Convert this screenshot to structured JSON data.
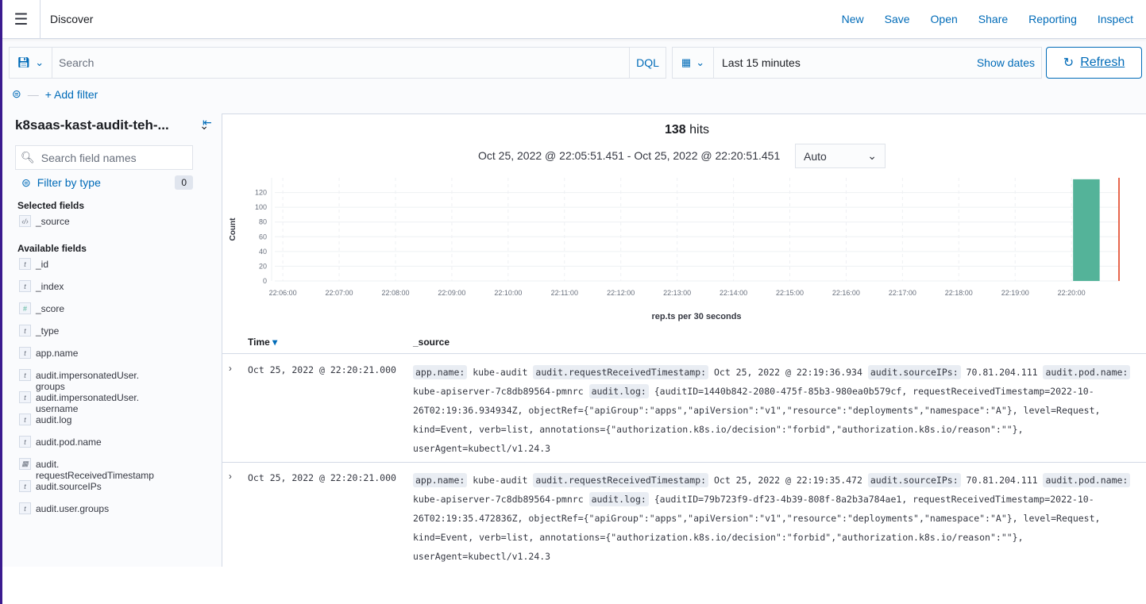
{
  "header": {
    "title": "Discover",
    "links": [
      "New",
      "Save",
      "Open",
      "Share",
      "Reporting",
      "Inspect"
    ]
  },
  "query": {
    "placeholder": "Search",
    "language": "DQL"
  },
  "time": {
    "range": "Last 15 minutes",
    "show_dates": "Show dates",
    "refresh": "Refresh"
  },
  "filters": {
    "add": "+ Add filter"
  },
  "sidebar": {
    "index_pattern": "k8saas-kast-audit-teh-...",
    "search_placeholder": "Search field names",
    "filter_by_type": "Filter by type",
    "filter_count": "0",
    "selected_title": "Selected fields",
    "selected": [
      {
        "type": "source",
        "name": "_source"
      }
    ],
    "available_title": "Available fields",
    "available": [
      {
        "type": "t",
        "name": "_id"
      },
      {
        "type": "t",
        "name": "_index"
      },
      {
        "type": "#",
        "name": "_score"
      },
      {
        "type": "t",
        "name": "_type"
      },
      {
        "type": "t",
        "name": "app.name"
      },
      {
        "type": "t",
        "name": "audit.impersonatedUser.\ngroups"
      },
      {
        "type": "t",
        "name": "audit.impersonatedUser.\nusername"
      },
      {
        "type": "t",
        "name": "audit.log"
      },
      {
        "type": "t",
        "name": "audit.pod.name"
      },
      {
        "type": "date",
        "name": "audit.\nrequestReceivedTimestamp"
      },
      {
        "type": "t",
        "name": "audit.sourceIPs"
      },
      {
        "type": "t",
        "name": "audit.user.groups"
      }
    ]
  },
  "summary": {
    "hits": "138",
    "hits_label": "hits",
    "range": "Oct 25, 2022 @ 22:05:51.451 - Oct 25, 2022 @ 22:20:51.451",
    "interval": "Auto"
  },
  "chart_data": {
    "type": "bar",
    "xlabel": "rep.ts per 30 seconds",
    "ylabel": "Count",
    "x_ticks": [
      "22:06:00",
      "22:07:00",
      "22:08:00",
      "22:09:00",
      "22:10:00",
      "22:11:00",
      "22:12:00",
      "22:13:00",
      "22:14:00",
      "22:15:00",
      "22:16:00",
      "22:17:00",
      "22:18:00",
      "22:19:00",
      "22:20:00"
    ],
    "y_ticks": [
      0,
      20,
      40,
      60,
      80,
      100,
      120
    ],
    "xlim": [
      "22:05:51.451",
      "22:20:51.451"
    ],
    "bars": [
      {
        "x": "22:20:00",
        "value": 138
      }
    ],
    "bar_color": "#54b399",
    "now_marker": "22:20:51.451",
    "now_color": "#e7664c",
    "grid": true
  },
  "table": {
    "columns": [
      "Time",
      "_source"
    ],
    "rows": [
      {
        "time": "Oct 25, 2022 @ 22:20:21.000",
        "fields": [
          [
            "app.name:",
            "kube-audit"
          ],
          [
            "audit.requestReceivedTimestamp:",
            "Oct 25, 2022 @ 22:19:36.934"
          ],
          [
            "audit.sourceIPs:",
            "70.81.204.111"
          ],
          [
            "audit.pod.name:",
            "kube-apiserver-7c8db89564-pmnrc"
          ],
          [
            "audit.log:",
            "{auditID=1440b842-2080-475f-85b3-980ea0b579cf, requestReceivedTimestamp=2022-10-26T02:19:36.934934Z, objectRef={\"apiGroup\":\"apps\",\"apiVersion\":\"v1\",\"resource\":\"deployments\",\"namespace\":\"A\"}, level=Request, kind=Event, verb=list, annotations={\"authorization.k8s.io/decision\":\"forbid\",\"authorization.k8s.io/reason\":\"\"}, userAgent=kubectl/v1.24.3"
          ]
        ]
      },
      {
        "time": "Oct 25, 2022 @ 22:20:21.000",
        "fields": [
          [
            "app.name:",
            "kube-audit"
          ],
          [
            "audit.requestReceivedTimestamp:",
            "Oct 25, 2022 @ 22:19:35.472"
          ],
          [
            "audit.sourceIPs:",
            "70.81.204.111"
          ],
          [
            "audit.pod.name:",
            "kube-apiserver-7c8db89564-pmnrc"
          ],
          [
            "audit.log:",
            "{auditID=79b723f9-df23-4b39-808f-8a2b3a784ae1, requestReceivedTimestamp=2022-10-26T02:19:35.472836Z, objectRef={\"apiGroup\":\"apps\",\"apiVersion\":\"v1\",\"resource\":\"deployments\",\"namespace\":\"A\"}, level=Request, kind=Event, verb=list, annotations={\"authorization.k8s.io/decision\":\"forbid\",\"authorization.k8s.io/reason\":\"\"}, userAgent=kubectl/v1.24.3"
          ]
        ]
      }
    ]
  }
}
